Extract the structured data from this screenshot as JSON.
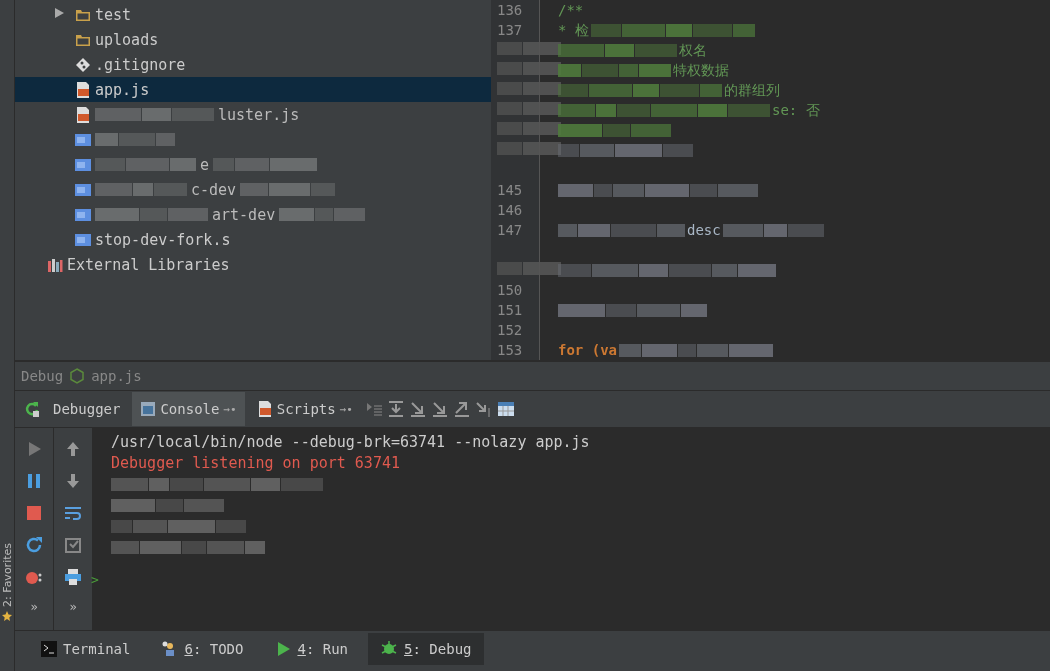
{
  "project_tree": {
    "items": [
      {
        "kind": "folder",
        "label": "test",
        "expanded": false,
        "selected": false
      },
      {
        "kind": "folder",
        "label": "uploads",
        "selected": false
      },
      {
        "kind": "git",
        "label": ".gitignore",
        "selected": false
      },
      {
        "kind": "js",
        "label": "app.js",
        "selected": true
      },
      {
        "kind": "js",
        "label": "luster.js",
        "blur_before": true,
        "selected": false
      },
      {
        "kind": "sh",
        "blur_before": true,
        "selected": false
      },
      {
        "kind": "sh",
        "label": "e",
        "blur_before": true,
        "blur_after": true,
        "selected": false
      },
      {
        "kind": "sh",
        "label": "c-dev",
        "blur_before": true,
        "blur_after": true,
        "selected": false
      },
      {
        "kind": "sh",
        "label": "art-dev",
        "blur_before": true,
        "blur_after": true,
        "selected": false
      },
      {
        "kind": "sh",
        "label": "stop-dev-fork.s",
        "selected": false
      }
    ],
    "external": {
      "label": "External Libraries"
    }
  },
  "editor": {
    "lines": [
      {
        "number": "136",
        "text": "/**",
        "kind": "comment"
      },
      {
        "number": "137",
        "text": "* 检",
        "kind": "comment",
        "blur_after": true
      },
      {
        "text": "权名",
        "kind": "comment",
        "blur_before": true
      },
      {
        "text": "特权数据",
        "kind": "comment",
        "blur_before": true
      },
      {
        "text": "的群组列",
        "kind": "comment",
        "blur_before": true
      },
      {
        "text": "se: 否",
        "kind": "comment",
        "blur_before": true
      },
      {
        "kind": "comment",
        "blur_before": true
      },
      {
        "kind": "code",
        "blur_before": true
      },
      {
        "kind": "blank"
      },
      {
        "number": "145",
        "kind": "code",
        "blur_before": true
      },
      {
        "number": "146",
        "kind": "blank"
      },
      {
        "number": "147",
        "text": "desc",
        "kind": "code",
        "blur_before": true,
        "blur_after": true
      },
      {
        "kind": "blank"
      },
      {
        "kind": "code",
        "blur_before": true
      },
      {
        "number": "150",
        "kind": "blank"
      },
      {
        "number": "151",
        "kind": "code",
        "blur_before": true
      },
      {
        "number": "152",
        "kind": "blank"
      },
      {
        "number": "153",
        "text": "for (va",
        "kind": "keyword",
        "blur_after": true
      }
    ]
  },
  "side_strip": {
    "label": "2: Favorites"
  },
  "debug": {
    "title": "Debug",
    "file": "app.js",
    "tabs": [
      {
        "label": "Debugger",
        "kind": "plain",
        "selected": false
      },
      {
        "label": "Console",
        "kind": "console",
        "pin": "→•",
        "selected": true
      },
      {
        "label": "Scripts",
        "kind": "js",
        "pin": "→•",
        "selected": false
      }
    ],
    "left_more": "»",
    "right_more": "»",
    "console": [
      {
        "text": "/usr/local/bin/node --debug-brk=63741 --nolazy app.js",
        "kind": "command"
      },
      {
        "text": "Debugger listening on port 63741",
        "kind": "error"
      },
      {
        "kind": "redacted"
      },
      {
        "kind": "redacted"
      },
      {
        "kind": "redacted"
      },
      {
        "kind": "redacted"
      }
    ],
    "prompt": ">"
  },
  "tool_windows": [
    {
      "kind": "terminal",
      "label": "Terminal",
      "selected": false
    },
    {
      "kind": "todo",
      "mnemonic": "6",
      "label": ": TODO",
      "selected": false
    },
    {
      "kind": "run",
      "mnemonic": "4",
      "label": ": Run",
      "selected": false
    },
    {
      "kind": "bug",
      "mnemonic": "5",
      "label": ": Debug",
      "selected": true
    }
  ]
}
